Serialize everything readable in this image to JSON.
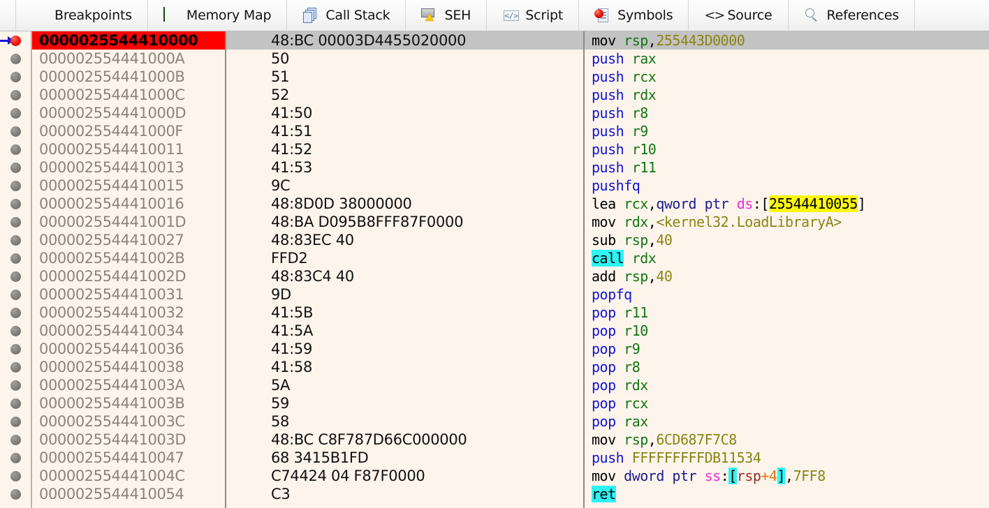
{
  "window": {
    "app": "x64dbg",
    "view": "Disassembly"
  },
  "colors": {
    "background": "#fdf5ec",
    "selected_address_bg": "#fe0000",
    "selected_row_bg": "#c3c3c3",
    "address_text": "#8d8378",
    "mnemonic_default": "#000000",
    "mnemonic_stack": "#1414d0",
    "register": "#137513",
    "constant": "#8a8413",
    "segment": "#ef27d4",
    "size_ptr": "#1a1a8c",
    "highlight_yellow": "#fbf80b",
    "highlight_cyan": "#2ff3f3",
    "mem_register": "#9b2d1f",
    "mem_operator": "#e07818",
    "breakpoint_active": "#ee1207",
    "breakpoint_inactive": "#7e7b77",
    "eip_arrow": "#1414d0"
  },
  "tabs": [
    {
      "label": "Breakpoints",
      "icon": "breakpoint-icon",
      "active": false
    },
    {
      "label": "Memory Map",
      "icon": "memory-chip-icon",
      "active": false
    },
    {
      "label": "Call Stack",
      "icon": "stacked-pages-icon",
      "active": false
    },
    {
      "label": "SEH",
      "icon": "warning-shield-icon",
      "active": false
    },
    {
      "label": "Script",
      "icon": "script-document-icon",
      "active": false
    },
    {
      "label": "Symbols",
      "icon": "symbols-document-icon",
      "active": false
    },
    {
      "label": "Source",
      "icon": "angle-brackets-icon",
      "active": false
    },
    {
      "label": "References",
      "icon": "magnifier-icon",
      "active": false
    }
  ],
  "disassembly": {
    "selected_index": 0,
    "rows": [
      {
        "address": "0000025544410000",
        "bytes": "48:BC 00003D4455020000",
        "breakpoint": "active",
        "eip": true,
        "selected": true,
        "tokens": [
          {
            "t": "mov",
            "c": "mn"
          },
          {
            "t": " ",
            "c": "sp"
          },
          {
            "t": "rsp",
            "c": "reg"
          },
          {
            "t": ",",
            "c": "punct"
          },
          {
            "t": "255443D0000",
            "c": "num"
          }
        ]
      },
      {
        "address": "000002554441000A",
        "bytes": "50",
        "breakpoint": "inactive",
        "tokens": [
          {
            "t": "push",
            "c": "mn-blue"
          },
          {
            "t": " ",
            "c": "sp"
          },
          {
            "t": "rax",
            "c": "reg"
          }
        ]
      },
      {
        "address": "000002554441000B",
        "bytes": "51",
        "breakpoint": "inactive",
        "tokens": [
          {
            "t": "push",
            "c": "mn-blue"
          },
          {
            "t": " ",
            "c": "sp"
          },
          {
            "t": "rcx",
            "c": "reg"
          }
        ]
      },
      {
        "address": "000002554441000C",
        "bytes": "52",
        "breakpoint": "inactive",
        "tokens": [
          {
            "t": "push",
            "c": "mn-blue"
          },
          {
            "t": " ",
            "c": "sp"
          },
          {
            "t": "rdx",
            "c": "reg"
          }
        ]
      },
      {
        "address": "000002554441000D",
        "bytes": "41:50",
        "breakpoint": "inactive",
        "tokens": [
          {
            "t": "push",
            "c": "mn-blue"
          },
          {
            "t": " ",
            "c": "sp"
          },
          {
            "t": "r8",
            "c": "reg"
          }
        ]
      },
      {
        "address": "000002554441000F",
        "bytes": "41:51",
        "breakpoint": "inactive",
        "tokens": [
          {
            "t": "push",
            "c": "mn-blue"
          },
          {
            "t": " ",
            "c": "sp"
          },
          {
            "t": "r9",
            "c": "reg"
          }
        ]
      },
      {
        "address": "0000025544410011",
        "bytes": "41:52",
        "breakpoint": "inactive",
        "tokens": [
          {
            "t": "push",
            "c": "mn-blue"
          },
          {
            "t": " ",
            "c": "sp"
          },
          {
            "t": "r10",
            "c": "reg"
          }
        ]
      },
      {
        "address": "0000025544410013",
        "bytes": "41:53",
        "breakpoint": "inactive",
        "tokens": [
          {
            "t": "push",
            "c": "mn-blue"
          },
          {
            "t": " ",
            "c": "sp"
          },
          {
            "t": "r11",
            "c": "reg"
          }
        ]
      },
      {
        "address": "0000025544410015",
        "bytes": "9C",
        "breakpoint": "inactive",
        "tokens": [
          {
            "t": "pushfq",
            "c": "mn-blue"
          }
        ]
      },
      {
        "address": "0000025544410016",
        "bytes": "48:8D0D 38000000",
        "breakpoint": "inactive",
        "tokens": [
          {
            "t": "lea",
            "c": "mn"
          },
          {
            "t": " ",
            "c": "sp"
          },
          {
            "t": "rcx",
            "c": "reg"
          },
          {
            "t": ",",
            "c": "punct"
          },
          {
            "t": "qword ptr ",
            "c": "ptr"
          },
          {
            "t": "ds",
            "c": "seg"
          },
          {
            "t": ":[",
            "c": "punct"
          },
          {
            "t": "25544410055",
            "c": "hl-yel"
          },
          {
            "t": "]",
            "c": "punct"
          }
        ]
      },
      {
        "address": "000002554441001D",
        "bytes": "48:BA D095B8FFF87F0000",
        "breakpoint": "inactive",
        "tokens": [
          {
            "t": "mov",
            "c": "mn"
          },
          {
            "t": " ",
            "c": "sp"
          },
          {
            "t": "rdx",
            "c": "reg"
          },
          {
            "t": ",",
            "c": "punct"
          },
          {
            "t": "<kernel32.LoadLibraryA>",
            "c": "num"
          }
        ]
      },
      {
        "address": "0000025544410027",
        "bytes": "48:83EC 40",
        "breakpoint": "inactive",
        "tokens": [
          {
            "t": "sub",
            "c": "mn"
          },
          {
            "t": " ",
            "c": "sp"
          },
          {
            "t": "rsp",
            "c": "reg"
          },
          {
            "t": ",",
            "c": "punct"
          },
          {
            "t": "40",
            "c": "num"
          }
        ]
      },
      {
        "address": "000002554441002B",
        "bytes": "FFD2",
        "breakpoint": "inactive",
        "tokens": [
          {
            "t": "call",
            "c": "mn-hl"
          },
          {
            "t": " ",
            "c": "sp"
          },
          {
            "t": "rdx",
            "c": "reg"
          }
        ]
      },
      {
        "address": "000002554441002D",
        "bytes": "48:83C4 40",
        "breakpoint": "inactive",
        "tokens": [
          {
            "t": "add",
            "c": "mn"
          },
          {
            "t": " ",
            "c": "sp"
          },
          {
            "t": "rsp",
            "c": "reg"
          },
          {
            "t": ",",
            "c": "punct"
          },
          {
            "t": "40",
            "c": "num"
          }
        ]
      },
      {
        "address": "0000025544410031",
        "bytes": "9D",
        "breakpoint": "inactive",
        "tokens": [
          {
            "t": "popfq",
            "c": "mn-blue"
          }
        ]
      },
      {
        "address": "0000025544410032",
        "bytes": "41:5B",
        "breakpoint": "inactive",
        "tokens": [
          {
            "t": "pop",
            "c": "mn-blue"
          },
          {
            "t": " ",
            "c": "sp"
          },
          {
            "t": "r11",
            "c": "reg"
          }
        ]
      },
      {
        "address": "0000025544410034",
        "bytes": "41:5A",
        "breakpoint": "inactive",
        "tokens": [
          {
            "t": "pop",
            "c": "mn-blue"
          },
          {
            "t": " ",
            "c": "sp"
          },
          {
            "t": "r10",
            "c": "reg"
          }
        ]
      },
      {
        "address": "0000025544410036",
        "bytes": "41:59",
        "breakpoint": "inactive",
        "tokens": [
          {
            "t": "pop",
            "c": "mn-blue"
          },
          {
            "t": " ",
            "c": "sp"
          },
          {
            "t": "r9",
            "c": "reg"
          }
        ]
      },
      {
        "address": "0000025544410038",
        "bytes": "41:58",
        "breakpoint": "inactive",
        "tokens": [
          {
            "t": "pop",
            "c": "mn-blue"
          },
          {
            "t": " ",
            "c": "sp"
          },
          {
            "t": "r8",
            "c": "reg"
          }
        ]
      },
      {
        "address": "000002554441003A",
        "bytes": "5A",
        "breakpoint": "inactive",
        "tokens": [
          {
            "t": "pop",
            "c": "mn-blue"
          },
          {
            "t": " ",
            "c": "sp"
          },
          {
            "t": "rdx",
            "c": "reg"
          }
        ]
      },
      {
        "address": "000002554441003B",
        "bytes": "59",
        "breakpoint": "inactive",
        "tokens": [
          {
            "t": "pop",
            "c": "mn-blue"
          },
          {
            "t": " ",
            "c": "sp"
          },
          {
            "t": "rcx",
            "c": "reg"
          }
        ]
      },
      {
        "address": "000002554441003C",
        "bytes": "58",
        "breakpoint": "inactive",
        "tokens": [
          {
            "t": "pop",
            "c": "mn-blue"
          },
          {
            "t": " ",
            "c": "sp"
          },
          {
            "t": "rax",
            "c": "reg"
          }
        ]
      },
      {
        "address": "000002554441003D",
        "bytes": "48:BC C8F787D66C000000",
        "breakpoint": "inactive",
        "tokens": [
          {
            "t": "mov",
            "c": "mn"
          },
          {
            "t": " ",
            "c": "sp"
          },
          {
            "t": "rsp",
            "c": "reg"
          },
          {
            "t": ",",
            "c": "punct"
          },
          {
            "t": "6CD687F7C8",
            "c": "num"
          }
        ]
      },
      {
        "address": "0000025544410047",
        "bytes": "68 3415B1FD",
        "breakpoint": "inactive",
        "tokens": [
          {
            "t": "push",
            "c": "mn-blue"
          },
          {
            "t": " ",
            "c": "sp"
          },
          {
            "t": "FFFFFFFFFDB11534",
            "c": "num"
          }
        ]
      },
      {
        "address": "000002554441004C",
        "bytes": "C74424 04 F87F0000",
        "breakpoint": "inactive",
        "tokens": [
          {
            "t": "mov",
            "c": "mn"
          },
          {
            "t": " ",
            "c": "sp"
          },
          {
            "t": "dword ptr ",
            "c": "ptr"
          },
          {
            "t": "ss",
            "c": "seg"
          },
          {
            "t": ":",
            "c": "punct"
          },
          {
            "t": "[",
            "c": "hl-cyan"
          },
          {
            "t": "rsp",
            "c": "memreg"
          },
          {
            "t": "+4",
            "c": "memop"
          },
          {
            "t": "]",
            "c": "hl-cyan"
          },
          {
            "t": ",",
            "c": "punct"
          },
          {
            "t": "7FF8",
            "c": "num"
          }
        ]
      },
      {
        "address": "0000025544410054",
        "bytes": "C3",
        "breakpoint": "inactive",
        "tokens": [
          {
            "t": "ret",
            "c": "mn-hl"
          }
        ]
      }
    ]
  }
}
